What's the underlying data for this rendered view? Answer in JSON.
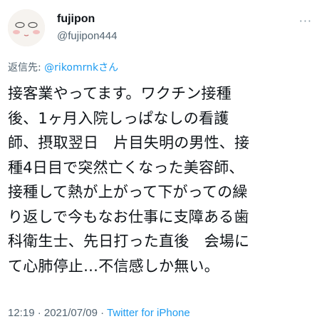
{
  "tweet": {
    "display_name": "fujipon",
    "handle": "@fujipon444",
    "more_icon": "more-dots-icon",
    "reply_prefix": "返信先: ",
    "reply_to": "@rikomrnkさん",
    "text": "接客業やってます。ワクチン接種\n後、1ヶ月入院しっぱなしの看護\n師、摂取翌日　片目失明の男性、接\n種4日目で突然亡くなった美容師、\n接種して熱が上がって下がっての繰\nり返しで今もなお仕事に支障ある歯\n科衛生士、先日打った直後　会場に\nて心肺停止…不信感しか無い。",
    "timestamp": "12:19 · 2021/07/09 · ",
    "source": "Twitter for iPhone"
  },
  "colors": {
    "link": "#1d9bf0",
    "secondary_text": "#536471",
    "primary_text": "#0f1419"
  }
}
